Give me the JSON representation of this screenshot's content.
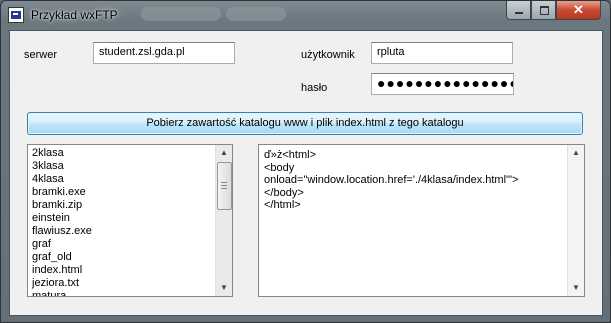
{
  "window": {
    "title": "Przykład wxFTP",
    "close_glyph": "✕"
  },
  "form": {
    "server_label": "serwer",
    "server_value": "student.zsl.gda.pl",
    "user_label": "użytkownik",
    "user_value": "rpluta",
    "password_label": "hasło",
    "password_value": "●●●●●●●●●●●●●●●●"
  },
  "fetch_button": {
    "label": "Pobierz zawartość katalogu www i plik index.html z tego katalogu"
  },
  "file_list": {
    "items": [
      "2klasa",
      "3klasa",
      "4klasa",
      "bramki.exe",
      "bramki.zip",
      "einstein",
      "flawiusz.exe",
      "graf",
      "graf_old",
      "index.html",
      "jeziora.txt",
      "matura"
    ]
  },
  "file_content": {
    "text": "ď»ż<html>\n<body\nonload=\"window.location.href='./4klasa/index.html'\">\n</body>\n</html>"
  },
  "scroll_glyphs": {
    "up": "▲",
    "down": "▼"
  }
}
